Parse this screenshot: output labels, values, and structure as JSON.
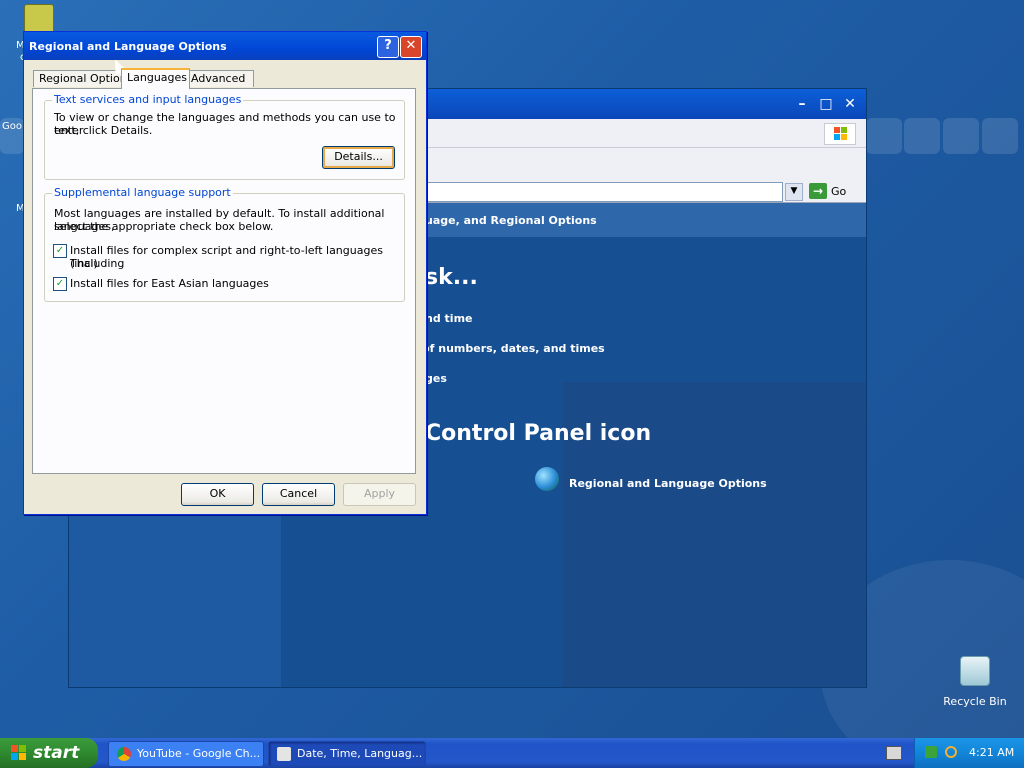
{
  "desktop": {
    "partial_labels": [
      "M",
      "c",
      "Goo",
      "M"
    ],
    "recycle_bin_label": "Recycle Bin"
  },
  "control_panel": {
    "address_go": "Go",
    "header": "uage, and Regional Options",
    "task_heading": "sk...",
    "tasks": [
      "nd time",
      "t of numbers, dates, and times",
      "ges"
    ],
    "icon_heading": "Control Panel icon",
    "icon_link": "Regional and Language Options"
  },
  "dialog": {
    "title": "Regional and Language Options",
    "tabs": [
      "Regional Options",
      "Languages",
      "Advanced"
    ],
    "group1": {
      "title": "Text services and input languages",
      "text_line1": "To view or change the languages and methods you can use to enter",
      "text_line2": "text, click Details.",
      "details_button": "Details..."
    },
    "group2": {
      "title": "Supplemental language support",
      "text_line1": "Most languages are installed by default. To install additional languages,",
      "text_line2": "select the appropriate check box below.",
      "check1_line1": "Install files for complex script and right-to-left languages (including",
      "check1_line2": "Thai)",
      "check2": "Install files for East Asian languages",
      "check1_checked": true,
      "check2_checked": true
    },
    "buttons": {
      "ok": "OK",
      "cancel": "Cancel",
      "apply": "Apply"
    }
  },
  "taskbar": {
    "start_label": "start",
    "tasks": [
      "YouTube - Google Ch...",
      "Date, Time, Languag..."
    ],
    "clock": "4:21 AM"
  },
  "colors": {
    "xp_blue": "#0a5be0",
    "start_green": "#2f8a2f",
    "group_title": "#0046d5"
  }
}
